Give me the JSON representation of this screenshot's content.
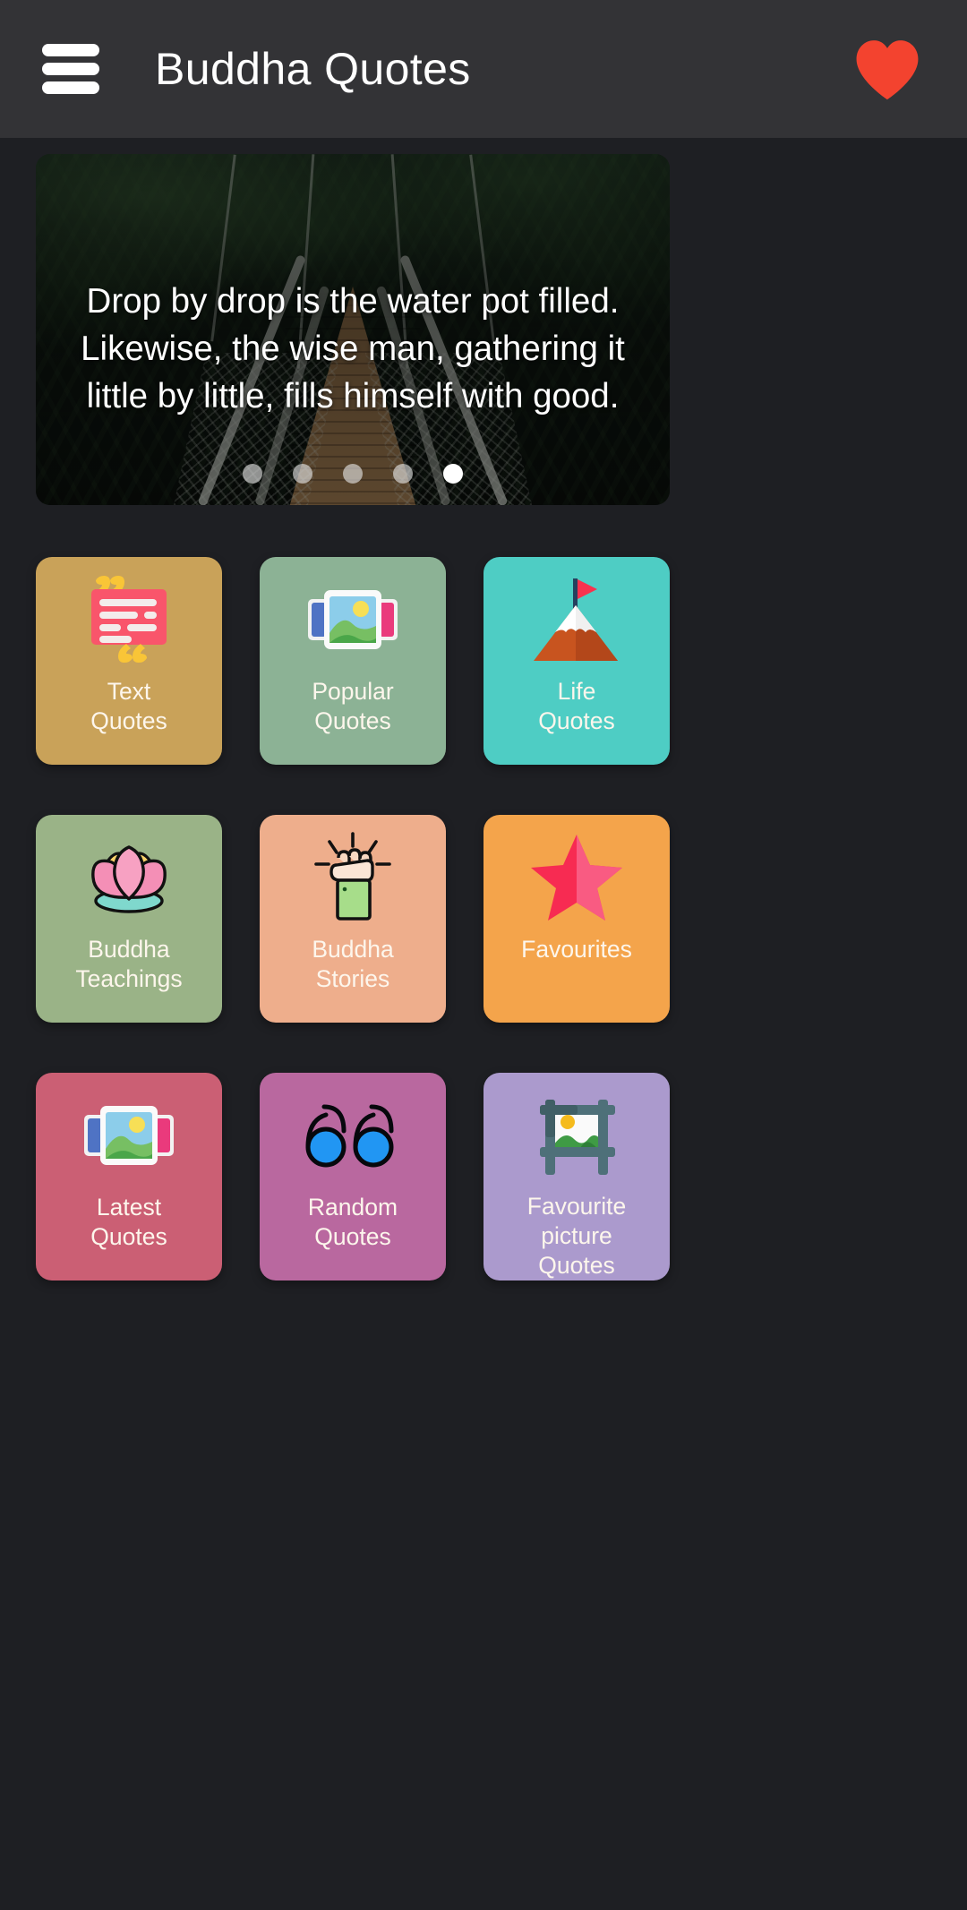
{
  "appbar": {
    "menu_icon": "hamburger-menu-icon",
    "title": "Buddha Quotes",
    "favourite_icon": "heart-icon",
    "heart_color": "#f3432f",
    "background": "#333336"
  },
  "hero": {
    "quote": "Drop by drop is the water pot filled.\nLikewise, the wise man, gathering it\nlittle by little, fills himself with good.",
    "image_description": "suspension-bridge-forest-photo",
    "dots_total": 5,
    "dot_active_index": 4
  },
  "grid": {
    "tiles": [
      {
        "id": "text-quotes",
        "label": "Text\nQuotes",
        "bg": "#c9a259",
        "icon": "quote-bubble-icon"
      },
      {
        "id": "popular-quotes",
        "label": "Popular\nQuotes",
        "bg": "#8cb295",
        "icon": "gallery-icon"
      },
      {
        "id": "life-quotes",
        "label": "Life\nQuotes",
        "bg": "#4ecdc4",
        "icon": "mountain-flag-icon"
      },
      {
        "id": "buddha-teachings",
        "label": "Buddha\nTeachings",
        "bg": "#9ab387",
        "icon": "lotus-icon"
      },
      {
        "id": "buddha-stories",
        "label": "Buddha\nStories",
        "bg": "#eeae8c",
        "icon": "raised-fist-icon"
      },
      {
        "id": "favourites",
        "label": "Favourites",
        "bg": "#f4a44b",
        "icon": "star-icon"
      },
      {
        "id": "latest-quotes",
        "label": "Latest\nQuotes",
        "bg": "#cb5f74",
        "icon": "gallery-icon"
      },
      {
        "id": "random-quotes",
        "label": "Random\nQuotes",
        "bg": "#b9689f",
        "icon": "double-quote-icon"
      },
      {
        "id": "favourite-picture-quotes",
        "label": "Favourite\npicture\nQuotes",
        "bg": "#ab9acd",
        "icon": "crop-image-icon"
      }
    ]
  },
  "theme": {
    "page_background": "#1e1f23",
    "label_color": "#fdf6ec"
  }
}
